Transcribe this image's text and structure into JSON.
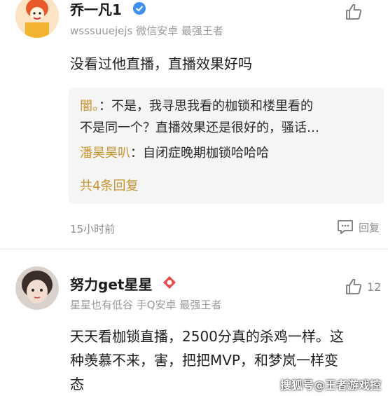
{
  "comments": [
    {
      "username": "乔一凡1",
      "meta": "wsssuuejejs 微信安卓 最强王者",
      "likes": "",
      "text": "没看过他直播，直播效果好吗",
      "replies": [
        {
          "name": "闇。",
          "text": "：不是，我寻思我看的枷锁和楼里看的",
          "text_cont": "不是同一个？直播效果还是很好的，骚话…"
        },
        {
          "name": "潘昊昊叭",
          "text": "：自闭症晚期枷锁哈哈哈"
        }
      ],
      "more_replies": "共4条回复",
      "time": "15小时前",
      "reply_label": "回复"
    },
    {
      "username": "努力get星星",
      "meta": "星星也有低谷 手Q安卓 最强王者",
      "likes": "12",
      "text_lines": [
        "天天看枷锁直播，2500分真的杀鸡一样。这",
        "种羡慕不来，害，把把MVP，和梦岚一样变",
        "态"
      ]
    }
  ],
  "watermark": "搜狐号@王者游戏控",
  "colors": {
    "accent": "#c9932e",
    "verified": "#3d8ff0",
    "badge": "#e84a4a"
  }
}
